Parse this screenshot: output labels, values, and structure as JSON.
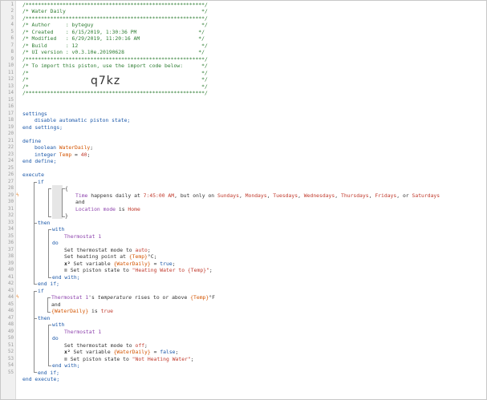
{
  "line_numbers": [
    "1",
    "2",
    "3",
    "4",
    "5",
    "6",
    "7",
    "8",
    "9",
    "10",
    "11",
    "12",
    "13",
    "14",
    "15",
    "16",
    "17",
    "18",
    "19",
    "20",
    "21",
    "22",
    "23",
    "24",
    "25",
    "26",
    "27",
    "28",
    "29",
    "30",
    "31",
    "32",
    "33",
    "34",
    "35",
    "36",
    "37",
    "38",
    "39",
    "40",
    "41",
    "42",
    "43",
    "44",
    "45",
    "46",
    "47",
    "48",
    "49",
    "50",
    "51",
    "52",
    "53",
    "54",
    "55"
  ],
  "header": {
    "border": "/**********************************************************/",
    "title": "/* Water Daily                                            */",
    "author": "/* Author     : byteguy                                   */",
    "created": "/* Created    : 6/15/2019, 1:30:36 PM                    */",
    "modified": "/* Modified   : 6/29/2019, 11:20:16 AM                   */",
    "build": "/* Build      : 12                                        */",
    "ui_version": "/* UI version : v0.3.10e.20190628                        */",
    "import_text": "/* To import this piston, use the import code below:      */",
    "blank_a": "/*                                                        */",
    "blank_b": "/*                                                        */",
    "blank_c": "/*                                                        */",
    "import_code": "q7kz"
  },
  "settings": {
    "open": "settings",
    "item": "disable automatic piston state;",
    "close": "end settings;"
  },
  "define": {
    "open": "define",
    "bool_type": "boolean",
    "bool_name": "WaterDaily",
    "bool_end": ";",
    "int_type": "integer",
    "int_name": "Temp",
    "int_eq": " = ",
    "int_value": "40",
    "int_end": ";",
    "close": "end define;"
  },
  "execute": {
    "open": "execute",
    "close": "end execute;",
    "if1": {
      "if": "if",
      "brace_open": "{",
      "brace_close": "}",
      "cond_time_kw": "Time",
      "cond_time_text": " happens daily at ",
      "cond_time_val": "7:45:00 AM",
      "cond_time_mid": ", but only on ",
      "days": [
        "Sundays",
        "Mondays",
        "Tuesdays",
        "Wednesdays",
        "Thursdays",
        "Fridays"
      ],
      "days_sep": ", ",
      "days_or": ", or ",
      "last_day": "Saturdays",
      "and": "and",
      "cond_loc_kw": "Location mode",
      "cond_loc_is": " is ",
      "cond_loc_val": "Home",
      "then": "then",
      "with": "with",
      "device": "Thermostat 1",
      "do": "do",
      "action1_text": "Set thermostat mode to ",
      "action1_val": "auto",
      "action1_end": ";",
      "action2_text": "Set heating point at ",
      "action2_val": "{Temp}",
      "action2_end": "°C;",
      "x_icon": "x²",
      "action3_text": " Set variable ",
      "action3_var": "{WaterDaily}",
      "action3_eq": " = ",
      "action3_val": "true",
      "action3_end": ";",
      "list_icon": "≣",
      "action4_text": " Set piston state to ",
      "action4_val": "\"Heating Water to {Temp}\"",
      "action4_end": ";",
      "end_with": "end with;",
      "end_if": "end if;"
    },
    "if2": {
      "if": "if",
      "cond1_dev": "Thermostat 1",
      "cond1_s": "'s ",
      "cond1_attr": "temperature",
      "cond1_text": " rises to or above ",
      "cond1_val": "{Temp}",
      "cond1_unit": "°F",
      "and": "and",
      "cond2_var": "{WaterDaily}",
      "cond2_is": " is ",
      "cond2_val": "true",
      "then": "then",
      "with": "with",
      "device": "Thermostat 1",
      "do": "do",
      "action1_text": "Set thermostat mode to ",
      "action1_val": "off",
      "action1_end": ";",
      "x_icon": "x²",
      "action2_text": " Set variable ",
      "action2_var": "{WaterDaily}",
      "action2_eq": " = ",
      "action2_val": "false",
      "action2_end": ";",
      "list_icon": "≣",
      "action3_text": " Set piston state to ",
      "action3_val": "\"Not Heating Water\"",
      "action3_end": ";",
      "end_with": "end with;",
      "end_if": "end if;"
    }
  },
  "flags": [
    "ϟ",
    "ϟ"
  ]
}
